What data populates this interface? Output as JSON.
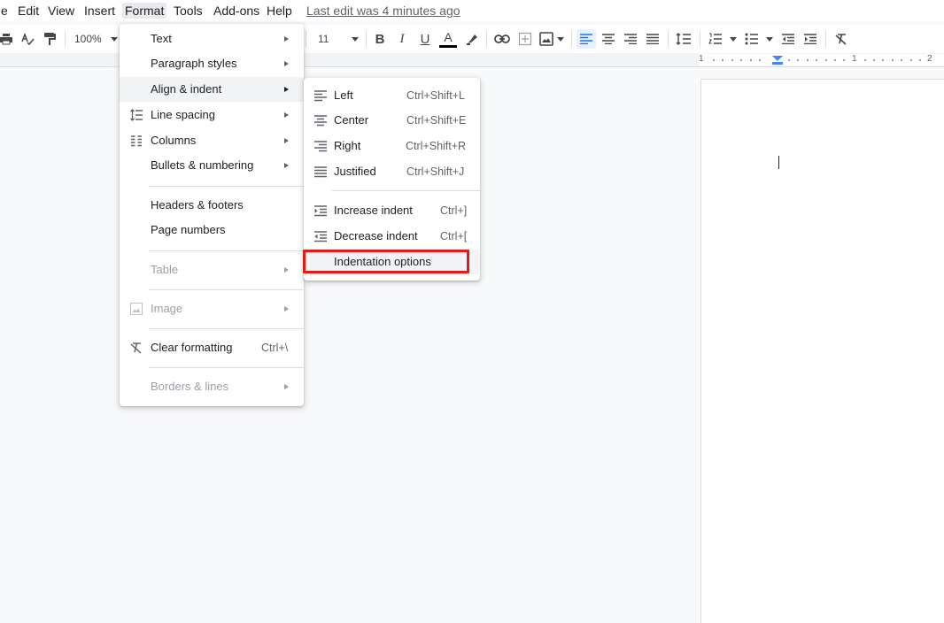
{
  "menubar": {
    "file_partial": "e",
    "edit": "Edit",
    "view": "View",
    "insert": "Insert",
    "format": "Format",
    "tools": "Tools",
    "addons": "Add-ons",
    "help": "Help",
    "last_edit": "Last edit was 4 minutes ago"
  },
  "toolbar": {
    "zoom": "100%",
    "font_size": "11",
    "bold": "B",
    "italic": "I",
    "underline": "U",
    "text_color_letter": "A",
    "accent": "#1a73e8",
    "active_alignment": "left"
  },
  "ruler": {
    "labels": [
      "1",
      "1",
      "2"
    ]
  },
  "format_menu": {
    "items": [
      {
        "label": "Text"
      },
      {
        "label": "Paragraph styles"
      },
      {
        "label": "Align & indent"
      },
      {
        "label": "Line spacing"
      },
      {
        "label": "Columns"
      },
      {
        "label": "Bullets & numbering"
      },
      {
        "label": "Headers & footers"
      },
      {
        "label": "Page numbers"
      },
      {
        "label": "Table"
      },
      {
        "label": "Image"
      },
      {
        "label": "Clear formatting",
        "shortcut": "Ctrl+\\"
      },
      {
        "label": "Borders & lines"
      }
    ]
  },
  "align_menu": {
    "items": [
      {
        "label": "Left",
        "shortcut": "Ctrl+Shift+L"
      },
      {
        "label": "Center",
        "shortcut": "Ctrl+Shift+E"
      },
      {
        "label": "Right",
        "shortcut": "Ctrl+Shift+R"
      },
      {
        "label": "Justified",
        "shortcut": "Ctrl+Shift+J"
      },
      {
        "label": "Increase indent",
        "shortcut": "Ctrl+]"
      },
      {
        "label": "Decrease indent",
        "shortcut": "Ctrl+["
      },
      {
        "label": "Indentation options"
      }
    ]
  },
  "colors": {
    "highlight_box": "#e21a1a",
    "hover_background": "#f1f3f4"
  }
}
